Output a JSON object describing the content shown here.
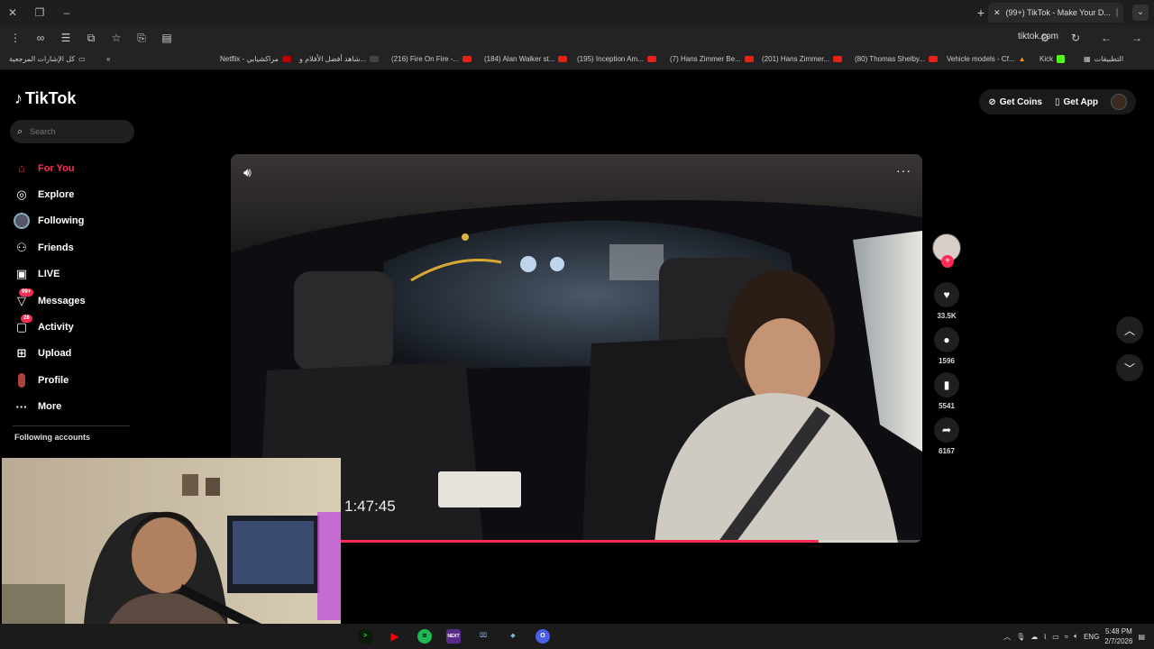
{
  "browser": {
    "tab_title": "(99+) TikTok - Make Your D...",
    "url": "tiktok.com",
    "bookmarks": [
      "كل الإشارات المرجعية",
      "Netflix - مراكشيابي",
      "شاهد أفضل الأفلام و...",
      "(216) Fire On Fire -...",
      "(184) Alan Walker st...",
      "(195) Inception Am...",
      "(7) Hans Zimmer Be...",
      "(201) Hans Zimmer...",
      "(80) Thomas Shelby...",
      "Vehicle models - Cf...",
      "Kick",
      "التطبيقات"
    ]
  },
  "tiktok": {
    "logo": "TikTok",
    "search_placeholder": "Search",
    "nav": [
      {
        "label": "For You",
        "icon": "home-icon"
      },
      {
        "label": "Explore",
        "icon": "compass-icon"
      },
      {
        "label": "Following",
        "icon": "following-avatar-icon"
      },
      {
        "label": "Friends",
        "icon": "friends-icon"
      },
      {
        "label": "LIVE",
        "icon": "live-icon"
      },
      {
        "label": "Messages",
        "icon": "messages-icon",
        "badge": "99+"
      },
      {
        "label": "Activity",
        "icon": "activity-icon",
        "badge": "26"
      },
      {
        "label": "Upload",
        "icon": "upload-icon"
      },
      {
        "label": "Profile",
        "icon": "profile-icon"
      },
      {
        "label": "More",
        "icon": "more-icon"
      }
    ],
    "following_accounts": "Following accounts",
    "get_coins": "Get Coins",
    "get_app": "Get App",
    "actions": {
      "likes": "33.5K",
      "comments": "1596",
      "saves": "5541",
      "shares": "6167"
    },
    "progress": 0.85
  },
  "overlay": {
    "timer": "1:47:45"
  },
  "taskbar": {
    "lang": "ENG",
    "time": "5:48 PM",
    "date": "2/7/2026"
  },
  "colors": {
    "accent": "#fe2c55",
    "bg": "#000000"
  }
}
